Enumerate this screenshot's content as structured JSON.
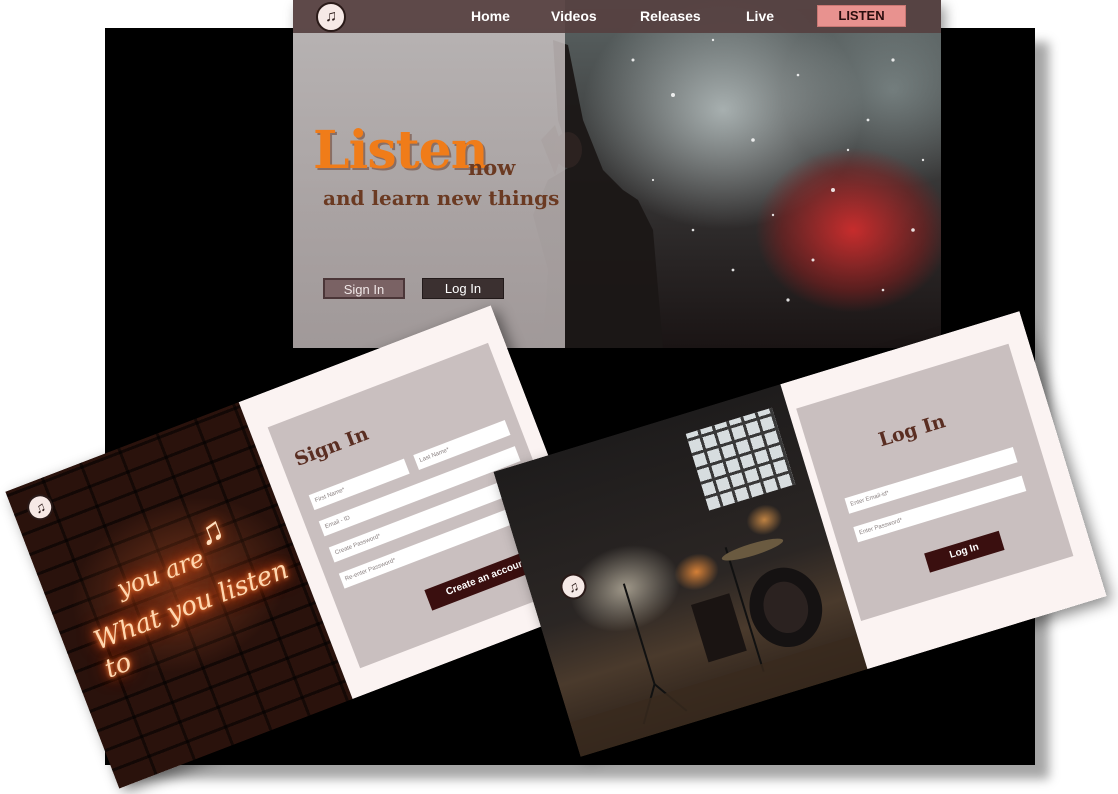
{
  "hero": {
    "nav": {
      "logo_glyph": "♫",
      "links": [
        "Home",
        "Videos",
        "Releases",
        "Live"
      ],
      "cta": "LISTEN"
    },
    "headline": "Listen",
    "headline_suffix": "now",
    "subheadline": "and learn new things",
    "buttons": {
      "signin": "Sign In",
      "login": "Log In"
    }
  },
  "signin": {
    "neon_line1": "you are",
    "neon_line2": "What you listen to",
    "neon_note": "♫",
    "title": "Sign In",
    "fields": {
      "first_name": "First Name*",
      "last_name": "Last Name*",
      "email": "Email - ID",
      "create_password": "Create Password*",
      "reenter_password": "Re-enter Password*"
    },
    "submit": "Create an account"
  },
  "login": {
    "title": "Log In",
    "fields": {
      "email": "Enter Email-id*",
      "password": "Enter Password*"
    },
    "submit": "Log In"
  },
  "colors": {
    "accent_orange": "#f07c19",
    "brand_brown": "#5a2e22",
    "cta_pink": "#e8928f",
    "dark_button": "#3a0f0f",
    "nav_bg": "#564040"
  },
  "icons": {
    "logo": "music-note-logo-icon"
  }
}
